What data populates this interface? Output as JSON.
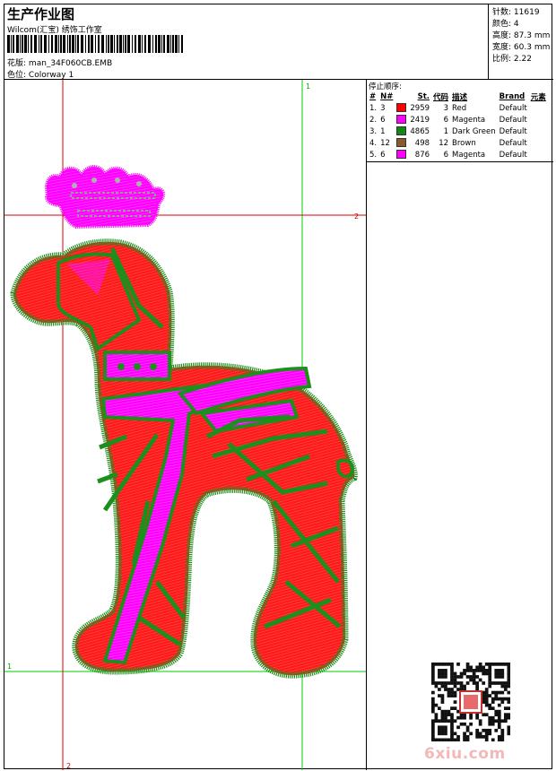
{
  "header": {
    "title": "生产作业图",
    "company": "Wilcom(汇宝) 绣饰工作室",
    "file_label": "花版:",
    "file_name": "man_34F060CB.EMB",
    "colorway_label": "色位:",
    "colorway_name": "Colorway 1"
  },
  "stats": [
    {
      "label": "针数",
      "value": "11619"
    },
    {
      "label": "颜色",
      "value": "4"
    },
    {
      "label": "高度",
      "value": "87.3 mm"
    },
    {
      "label": "宽度",
      "value": "60.3 mm"
    },
    {
      "label": "比例",
      "value": "2.22"
    }
  ],
  "legend": {
    "caption": "停止顺序:",
    "headers": [
      "#",
      "N#",
      "St.",
      "代码",
      "描述",
      "Brand",
      "元素"
    ],
    "rows": [
      {
        "num": "1.",
        "n": "3",
        "color": "#ff0000",
        "st": "2959",
        "code": "3",
        "desc": "Red",
        "brand": "Default"
      },
      {
        "num": "2.",
        "n": "6",
        "color": "#ff00ff",
        "st": "2419",
        "code": "6",
        "desc": "Magenta",
        "brand": "Default"
      },
      {
        "num": "3.",
        "n": "1",
        "color": "#128a12",
        "st": "4865",
        "code": "1",
        "desc": "Dark Green",
        "brand": "Default"
      },
      {
        "num": "4.",
        "n": "12",
        "color": "#8b5a2b",
        "st": "498",
        "code": "12",
        "desc": "Brown",
        "brand": "Default"
      },
      {
        "num": "5.",
        "n": "6",
        "color": "#ff00ff",
        "st": "876",
        "code": "6",
        "desc": "Magenta",
        "brand": "Default"
      }
    ]
  },
  "guides": {
    "v1": "1",
    "h2": "2",
    "h1": "1",
    "v2": "2"
  },
  "watermark": "6xiu.com"
}
